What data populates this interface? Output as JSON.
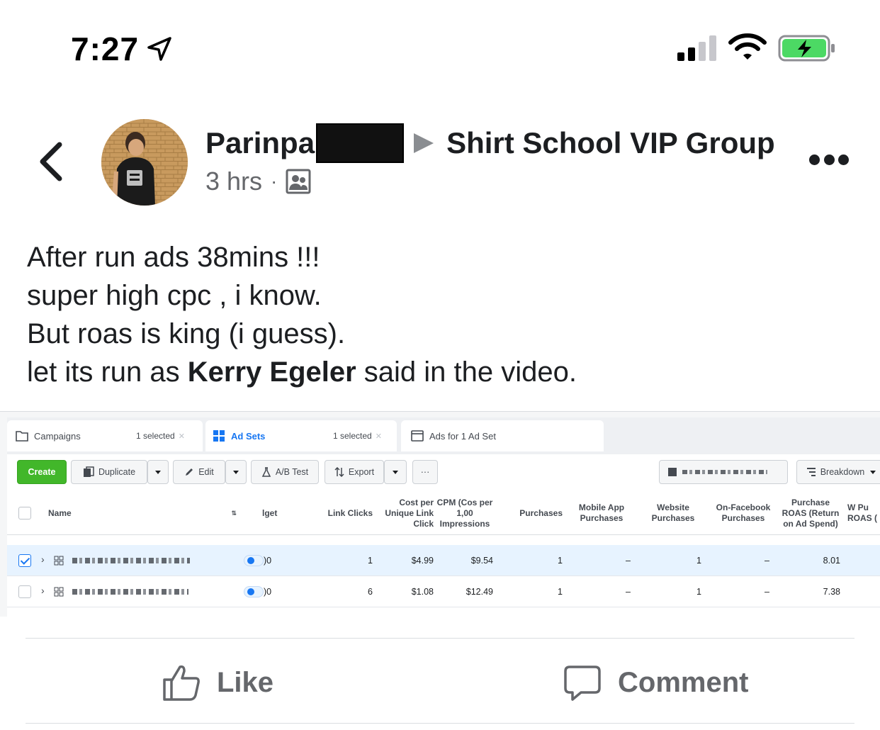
{
  "status_bar": {
    "time": "7:27",
    "icons": [
      "location-arrow-icon",
      "cellular-signal-icon",
      "wifi-icon",
      "battery-charging-icon"
    ],
    "battery_color": "#4cd964"
  },
  "post": {
    "author_name": "Parinpa",
    "group_name": "Shirt School VIP Group",
    "time_ago": "3 hrs",
    "meta_separator": "·",
    "body_lines": [
      "After run ads 38mins !!!",
      "super high cpc , i know.",
      "But roas is king (i guess)."
    ],
    "body_last_prefix": "let its run as ",
    "body_last_mention": "Kerry Egeler",
    "body_last_suffix": " said in the video."
  },
  "ads_manager": {
    "tabs": {
      "campaigns": "Campaigns",
      "campaigns_selected": "1 selected",
      "adsets": "Ad Sets",
      "adsets_selected": "1 selected",
      "ads": "Ads for 1 Ad Set"
    },
    "toolbar": {
      "create": "Create",
      "duplicate": "Duplicate",
      "edit": "Edit",
      "ab_test": "A/B Test",
      "export": "Export",
      "more": "···",
      "breakdown": "Breakdown"
    },
    "columns": {
      "name": "Name",
      "budget": "lget",
      "link_clicks": "Link Clicks",
      "cost_per_unique_link_click": "Cost per Unique Link Click",
      "cpm": "CPM (Cos per 1,00 Impressions",
      "purchases": "Purchases",
      "mobile_app_purchases": "Mobile App Purchases",
      "website_purchases": "Website Purchases",
      "on_facebook_purchases": "On-Facebook Purchases",
      "purchase_roas": "Purchase ROAS (Return on Ad Spend)",
      "website_purchase_roas_partial": "W Pu ROAS ("
    },
    "rows": [
      {
        "budget": ")0",
        "link_clicks": "1",
        "cost_per_unique_link_click": "$4.99",
        "cpm": "$9.54",
        "purchases": "1",
        "mobile_app_purchases": "–",
        "website_purchases": "1",
        "on_facebook_purchases": "–",
        "purchase_roas": "8.01"
      },
      {
        "budget": ")0",
        "link_clicks": "6",
        "cost_per_unique_link_click": "$1.08",
        "cpm": "$12.49",
        "purchases": "1",
        "mobile_app_purchases": "–",
        "website_purchases": "1",
        "on_facebook_purchases": "–",
        "purchase_roas": "7.38"
      }
    ]
  },
  "actions": {
    "like": "Like",
    "comment": "Comment"
  }
}
